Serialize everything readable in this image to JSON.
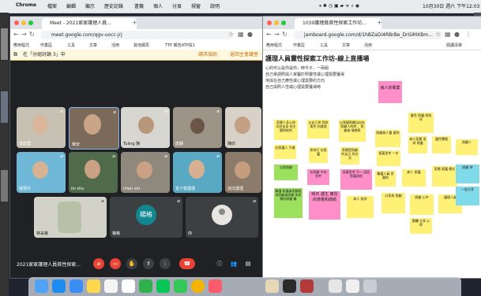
{
  "menubar": {
    "app_name": "Chrome",
    "menus": [
      "檔案",
      "編輯",
      "顯示",
      "歷史記錄",
      "書籤",
      "個人",
      "分頁",
      "視窗",
      "說明"
    ],
    "clock": "10月30日 週六 下午12:03"
  },
  "meet_window": {
    "tab_title": "Meet - 2021家家護理人員...",
    "url": "meet.google.com/qgv-uocc-jrj",
    "bookmarks": [
      "應用程式",
      "作業區",
      "工具",
      "文章",
      "活用",
      "其他網頁",
      "TTP 報告ATP投1"
    ],
    "breakout_label": "在「分組討論 3」中",
    "breakout_links": [
      "請求協助",
      "返回主會議室"
    ],
    "participants": [
      {
        "name": "李碧霞"
      },
      {
        "name": "陳安"
      },
      {
        "name": "Tuling 陳"
      },
      {
        "name": "唐靜"
      },
      {
        "name": "陳欣"
      },
      {
        "name": "徐慧玲"
      },
      {
        "name": "lin shu"
      },
      {
        "name": "chen xin"
      },
      {
        "name": "曾少雯護理"
      },
      {
        "name": "加法護理"
      },
      {
        "name": "林采薇"
      },
      {
        "name": "楊格",
        "initials": "楊格"
      },
      {
        "name": "你"
      }
    ],
    "meeting_name": "2021家家護理人員首性探索..."
  },
  "jam_window": {
    "tab_title": "1030護理員首性探索工作坊...",
    "url": "jamboard.google.com/d/1hBZaDi4RBrBe_DrGiMXBm...",
    "bookmarks": [
      "應用程式",
      "作業區",
      "工具",
      "文章",
      "活用"
    ],
    "other_bookmarks": "閱讀清單",
    "title": "護理人員靈性探索工作坊-線上直播場",
    "lines": [
      "心的可以是你是你，時今子，一兩組",
      "自己單調照與人家屬於照靈性或心理需要獲得",
      "地與在自己療性或心理需要的方向",
      "自己與照人性或心理需要獲得時"
    ],
    "notes": [
      {
        "text": "病人的專業",
        "color": "pink"
      },
      {
        "text": "家屬人身心與 兒對自身 的主題與依附",
        "color": "yellow"
      },
      {
        "text": "以自己與 我與 角色 的處理",
        "color": "yellow"
      },
      {
        "text": "以我優照顧自自在照顧人的時 ，照顧者 情緒表",
        "color": "yellow"
      },
      {
        "text": "在照護人 不會",
        "color": "yellow"
      },
      {
        "text": "如何打 在照護",
        "color": "yellow"
      },
      {
        "text": "家屬是照顧的自己 的方式",
        "color": "yellow"
      },
      {
        "text": "照顧病人重 要的",
        "color": "yellow"
      },
      {
        "text": "靈性 照護 與陪伴",
        "color": "yellow"
      },
      {
        "text": "病人家屬 家與 照護",
        "color": "yellow"
      },
      {
        "text": "接著思考 一步",
        "color": "yellow"
      },
      {
        "text": "靈性關懷",
        "color": "yellow"
      },
      {
        "text": "照顧人",
        "color": "yellow"
      },
      {
        "text": "自我照顧",
        "color": "green"
      },
      {
        "text": "在照顧 中的 思考",
        "color": "pink"
      },
      {
        "text": "接著思考 不一 因此 照護過程",
        "color": "pink"
      },
      {
        "text": "醫護人員 家屬的",
        "color": "yellow"
      },
      {
        "text": "病人 照護",
        "color": "yellow"
      },
      {
        "text": "家屬 照護 模式",
        "color": "yellow"
      },
      {
        "text": "醫護‧照護者照顧照 與照顧者照顧 與家屬的照顧 醫",
        "color": "green"
      },
      {
        "text": "晴天 護生 實習的感覺和總結",
        "color": "pink"
      },
      {
        "text": "病人 陪伴",
        "color": "yellow"
      },
      {
        "text": "分享與 照顧",
        "color": "yellow"
      },
      {
        "text": "照顧 心中",
        "color": "yellow"
      },
      {
        "text": "護理人員",
        "color": "yellow"
      },
      {
        "text": "團體 分享 心得",
        "color": "yellow"
      },
      {
        "text": "照顧 時",
        "color": "cyan"
      },
      {
        "text": "一起分享",
        "color": "cyan"
      }
    ]
  },
  "dock": {
    "apps": [
      "finder-icon",
      "app-store-icon",
      "mail-icon",
      "notes-icon",
      "reminders-icon",
      "calendar-icon",
      "numbers-icon",
      "line-icon",
      "messages-icon",
      "chrome-icon",
      "music-icon",
      "preview-icon",
      "screenshot-icon",
      "word-icon",
      "dictionary-icon",
      "text-edit-icon",
      "trash-icon"
    ]
  },
  "colors": {
    "meet_bg": "#202124",
    "end_call": "#ea4335",
    "sticky_yellow": "#fff176",
    "sticky_green": "#9be15d",
    "sticky_pink": "#ff8fc8",
    "sticky_cyan": "#7fdbea"
  }
}
